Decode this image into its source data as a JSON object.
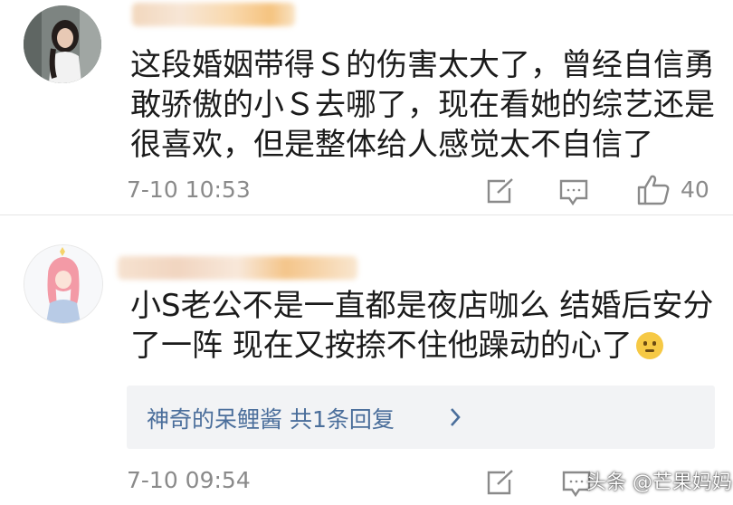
{
  "comments": [
    {
      "text_lines": [
        "这段婚姻带得Ｓ的伤害太大了，曾经自信勇",
        "敢骄傲的小Ｓ去哪了，现在看她的综艺还是",
        "很喜欢，但是整体给人感觉太不自信了"
      ],
      "time": "7-10 10:53",
      "likes": "40",
      "icons": {
        "edit": "edit-icon",
        "reply": "comment-icon",
        "like": "thumbs-up-icon"
      }
    },
    {
      "text_lines": [
        "小S老公不是一直都是夜店咖么 结婚后安分",
        "了一阵 现在又按捺不住他躁动的心了"
      ],
      "emoji": "confused-emoji",
      "reply_link": "神奇的呆鲤酱  共1条回复",
      "time": "7-10 09:54",
      "icons": {
        "edit": "edit-icon",
        "reply": "comment-icon",
        "chevron": "chevron-right-icon"
      }
    }
  ],
  "watermark": "头条 @芒果妈妈",
  "colors": {
    "link": "#4a6e9b",
    "meta": "#8a8a8a",
    "reply_bg": "#f2f3f5"
  }
}
